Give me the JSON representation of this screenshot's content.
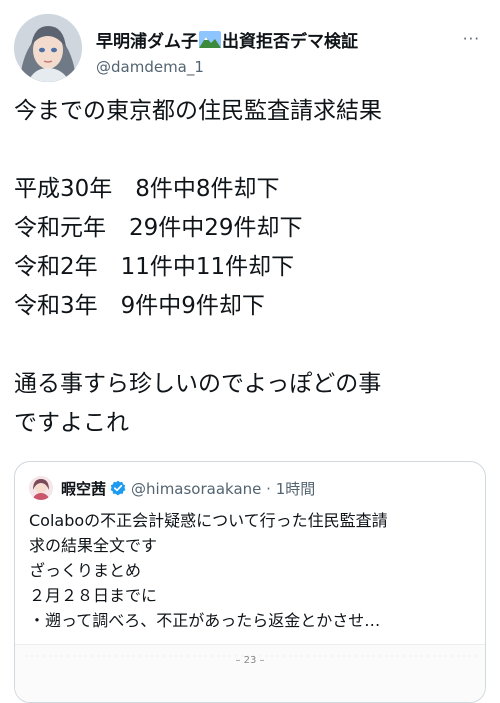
{
  "author": {
    "display_name_part1": "早明浦ダム子",
    "display_name_part2": "出資拒否デマ検証",
    "handle": "@damdema_1",
    "more_label": "···"
  },
  "tweet": {
    "lines": [
      "今までの東京都の住民監査請求結果",
      "",
      "平成30年　8件中8件却下",
      "令和元年　29件中29件却下",
      "令和2年　11件中11件却下",
      "令和3年　9件中9件却下",
      "",
      "通る事すら珍しいのでよっぽどの事",
      "ですよこれ"
    ]
  },
  "quoted_tweet": {
    "display_name": "暇空茜",
    "handle_time": "@himasoraakane · 1時間",
    "lines": [
      "Colaboの不正会計疑惑について行った住民監査請",
      "求の結果全文です",
      "ざっくりまとめ",
      "２月２８日までに",
      "・遡って調べろ、不正があったら返金とかさせ…"
    ],
    "image_page_number": "– 23 –"
  },
  "colors": {
    "text": "#0f1419",
    "secondary": "#536471",
    "border": "#cfd9de",
    "verified": "#1d9bf0"
  },
  "icons": [
    "avatar",
    "mountain-emoji-icon",
    "more-icon",
    "verified-badge-icon"
  ]
}
